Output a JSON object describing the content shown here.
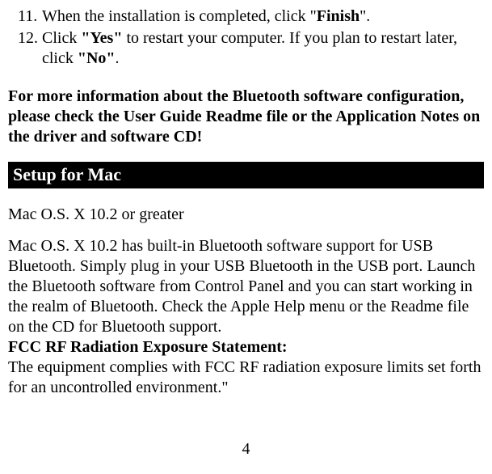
{
  "list": {
    "items": [
      {
        "number": "11.",
        "prefix": "When the installation is completed, click \"",
        "bold1": "Finish",
        "suffix": "\"."
      },
      {
        "number": "12.",
        "prefix": "Click ",
        "bold1": "\"Yes\"",
        "mid": " to restart your computer. If you plan to restart later, click ",
        "bold2": "\"No\"",
        "suffix2": "."
      }
    ]
  },
  "info_paragraph": "For more information about the Bluetooth software configuration, please check the User Guide Readme file or the Application Notes on the driver and software CD!",
  "section_header": "Setup for Mac",
  "sub_heading": "Mac O.S. X 10.2 or greater",
  "body_text": "Mac O.S. X 10.2 has built-in Bluetooth software support for USB Bluetooth. Simply plug in your USB Bluetooth in the USB port. Launch the Bluetooth software from Control Panel and you can start working in the realm of Bluetooth. Check the Apple Help menu or the Readme file on the CD for Bluetooth support.",
  "fcc_heading": "FCC RF Radiation Exposure Statement:",
  "fcc_text": "The equipment complies with FCC RF radiation exposure limits set forth for an uncontrolled environment.\"",
  "page_number": "4"
}
